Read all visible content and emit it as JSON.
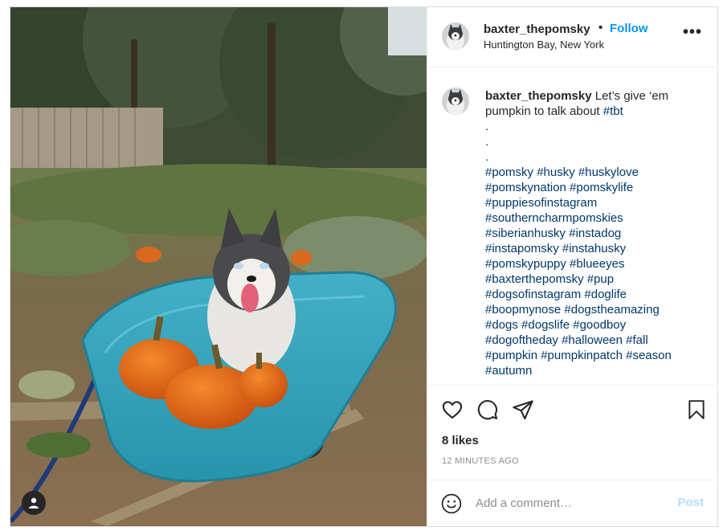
{
  "post": {
    "username": "baxter_thepomsky",
    "dot": "•",
    "follow_label": "Follow",
    "location": "Huntington Bay, New York",
    "more_label": "•••",
    "caption": {
      "username": "baxter_thepomsky",
      "text": "Let’s give ‘em pumpkin to talk about",
      "first_tag": "#tbt",
      "dots": [
        ".",
        ".",
        "."
      ],
      "hashtag_lines": [
        "#pomsky #husky #huskylove",
        "#pomskynation #pomskylife",
        "#puppiesofinstagram",
        "#southerncharmpomskies",
        "#siberianhusky #instadog",
        "#instapomsky #instahusky",
        "#pomskypuppy #blueeyes",
        "#baxterthepomsky #pup",
        "#dogsofinstagram #doglife",
        "#boopmynose #dogstheamazing",
        "#dogs #dogslife #goodboy",
        "#dogoftheday #halloween #fall",
        "#pumpkin #pumpkinpatch #season",
        "#autumn"
      ]
    },
    "likes": "8 likes",
    "time_ago": "12 MINUTES AGO"
  },
  "icons": {
    "like": "heart-icon",
    "comment": "comment-bubble-icon",
    "share": "paper-plane-icon",
    "save": "bookmark-icon",
    "emoji": "smiley-icon",
    "photo_tag": "user-tag-icon"
  },
  "comment_box": {
    "placeholder": "Add a comment…",
    "post_label": "Post"
  },
  "colors": {
    "link_blue": "#0095f6",
    "hashtag": "#00376b",
    "post_disabled": "#b2dffc",
    "muted": "#8e8e8e"
  }
}
